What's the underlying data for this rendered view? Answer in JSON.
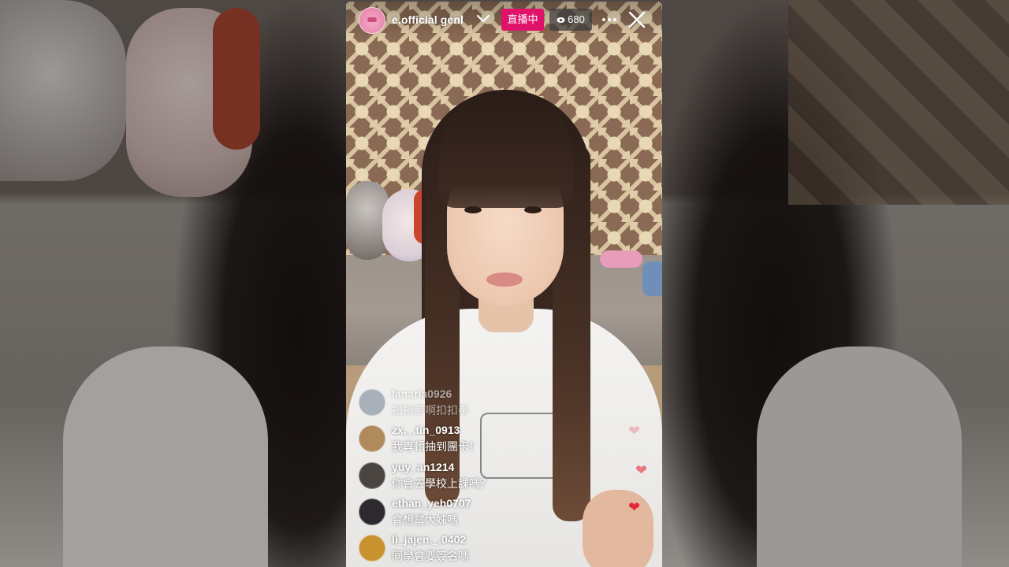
{
  "stream": {
    "username": "e.official  genl",
    "live_label": "直播中",
    "viewer_count": "680",
    "icons": {
      "viewers": "eye-icon",
      "more": "more-horizontal-icon",
      "close": "close-icon",
      "dropdown": "chevron-down-icon"
    },
    "accent_color": "#e0136a"
  },
  "comments": [
    {
      "user": "lanarla0926",
      "text": "扣扣拳啊扣扣拳",
      "avatar_color": "#6f7f93"
    },
    {
      "user": "zx._.tin_0913",
      "text": "我專輯抽到團卡！",
      "avatar_color": "#b08a5a"
    },
    {
      "user": "yuy_an1214",
      "text": "你會去學校上課嗎？",
      "avatar_color": "#4a4540"
    },
    {
      "user": "ethan_yeh0707",
      "text": "會想當大姊嗎",
      "avatar_color": "#2d2a2f"
    },
    {
      "user": "li_jajen._.0402",
      "text": "同學會要簽名嗎",
      "avatar_color": "#c8922f"
    }
  ]
}
